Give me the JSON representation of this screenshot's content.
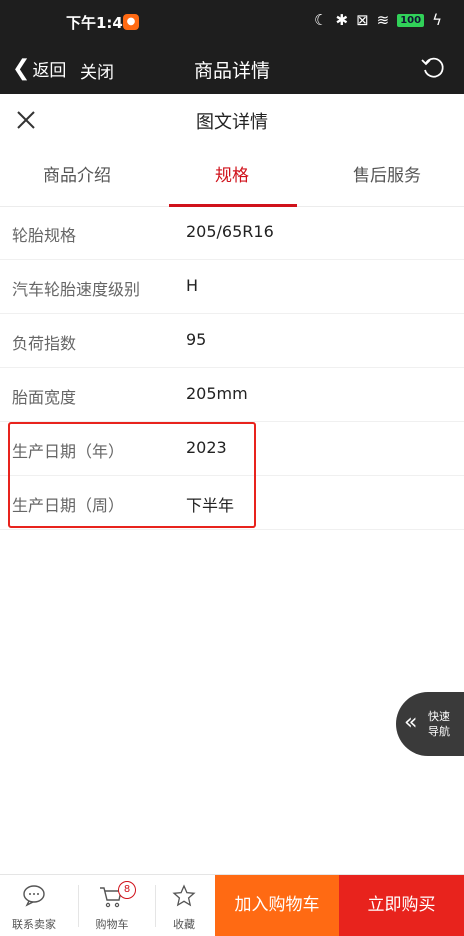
{
  "status_bar": {
    "time": "下午1:40",
    "battery": "100"
  },
  "nav": {
    "back": "返回",
    "close": "关闭",
    "title": "商品详情"
  },
  "sub_header": {
    "title": "图文详情"
  },
  "tabs": [
    {
      "label": "商品介绍"
    },
    {
      "label": "规格",
      "active": true
    },
    {
      "label": "售后服务"
    }
  ],
  "specs": [
    {
      "label": "轮胎规格",
      "value": "205/65R16"
    },
    {
      "label": "汽车轮胎速度级别",
      "value": "H"
    },
    {
      "label": "负荷指数",
      "value": "95"
    },
    {
      "label": "胎面宽度",
      "value": "205mm"
    },
    {
      "label": "生产日期（年）",
      "value": "2023"
    },
    {
      "label": "生产日期（周）",
      "value": "下半年"
    }
  ],
  "quick_nav": {
    "line1": "快速",
    "line2": "导航"
  },
  "bottom_bar": {
    "contact": "联系卖家",
    "cart": "购物车",
    "cart_count": "8",
    "favorite": "收藏",
    "add_to_cart": "加入购物车",
    "buy_now": "立即购买"
  },
  "colors": {
    "accent": "#d0121b",
    "orange": "#ff6a13",
    "red": "#e8231d",
    "header": "#1e1e1e"
  }
}
